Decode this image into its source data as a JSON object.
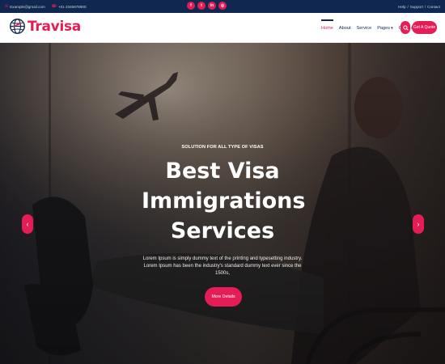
{
  "topbar": {
    "email": "Example@gmail.com",
    "phone": "+01 2345678900",
    "socials": [
      {
        "icon": "facebook-icon",
        "glyph": "f"
      },
      {
        "icon": "twitter-icon",
        "glyph": "t"
      },
      {
        "icon": "linkedin-icon",
        "glyph": "in"
      },
      {
        "icon": "instagram-icon",
        "glyph": "◎"
      }
    ],
    "links": [
      "Help",
      "/",
      "Support",
      "/",
      "Contact"
    ]
  },
  "logo": {
    "text": "Travisa"
  },
  "nav": {
    "items": [
      "Home",
      "About",
      "Service",
      "Pages",
      "Contact"
    ],
    "active": "Home",
    "quote_label": "Get A Quote"
  },
  "hero": {
    "tagline": "SOLUTION FOR ALL TYPE OF VISAS",
    "title_lines": [
      "Best Visa",
      "Immigrations",
      "Services"
    ],
    "text": "Lorem Ipsum is simply dummy text of the printing and typesetting industry. Lorem Ipsum has been the industry's standard dummy text ever since the 1500s,",
    "button": "More Details",
    "prev_glyph": "‹",
    "next_glyph": "›"
  },
  "colors": {
    "accent": "#e41d57",
    "navy": "#10284f"
  }
}
